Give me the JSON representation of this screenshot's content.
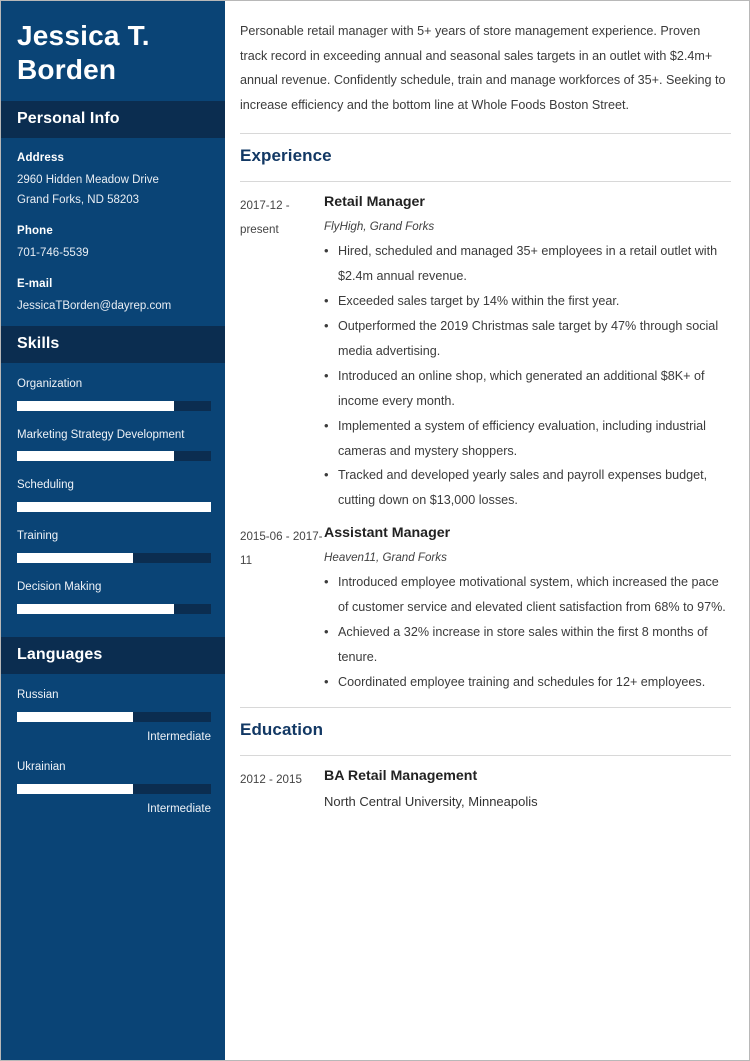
{
  "sidebar": {
    "name_lines": [
      "Jessica T.",
      "Borden"
    ],
    "personal_info": {
      "heading": "Personal Info",
      "groups": [
        {
          "label": "Address",
          "values": [
            "2960 Hidden Meadow Drive",
            "Grand Forks, ND 58203"
          ]
        },
        {
          "label": "Phone",
          "values": [
            "701-746-5539"
          ]
        },
        {
          "label": "E-mail",
          "values": [
            "JessicaTBorden@dayrep.com"
          ]
        }
      ]
    },
    "skills": {
      "heading": "Skills",
      "items": [
        {
          "label": "Organization",
          "level": 81
        },
        {
          "label": "Marketing Strategy Development",
          "level": 81
        },
        {
          "label": "Scheduling",
          "level": 100
        },
        {
          "label": "Training",
          "level": 60
        },
        {
          "label": "Decision Making",
          "level": 81
        }
      ]
    },
    "languages": {
      "heading": "Languages",
      "items": [
        {
          "label": "Russian",
          "level": 60,
          "level_label": "Intermediate"
        },
        {
          "label": "Ukrainian",
          "level": 60,
          "level_label": "Intermediate"
        }
      ]
    }
  },
  "main": {
    "summary": "Personable retail manager with 5+ years of store management experience. Proven track record in exceeding annual and seasonal sales targets in an outlet with $2.4m+ annual revenue. Confidently schedule, train and manage workforces of 35+. Seeking to increase efficiency and the bottom line at Whole Foods Boston Street.",
    "experience": {
      "heading": "Experience",
      "entries": [
        {
          "dates": "2017-12 - present",
          "title": "Retail Manager",
          "subtitle": "FlyHigh, Grand Forks",
          "bullets": [
            "Hired, scheduled and managed 35+ employees in a retail outlet with $2.4m annual revenue.",
            "Exceeded sales target by 14% within the first year.",
            "Outperformed the 2019 Christmas sale target by 47% through social media advertising.",
            "Introduced an online shop, which generated an additional $8K+ of income every month.",
            "Implemented a system of efficiency evaluation, including industrial cameras and mystery shoppers.",
            "Tracked and developed yearly sales and payroll expenses budget, cutting down on $13,000 losses."
          ]
        },
        {
          "dates": "2015-06 - 2017-11",
          "title": "Assistant Manager",
          "subtitle": "Heaven11, Grand Forks",
          "bullets": [
            "Introduced employee motivational system, which increased the pace of customer service and elevated client satisfaction from 68% to 97%.",
            "Achieved a 32% increase in store sales within the first 8 months of tenure.",
            "Coordinated employee training and schedules for 12+ employees."
          ]
        }
      ]
    },
    "education": {
      "heading": "Education",
      "entries": [
        {
          "dates": "2012 - 2015",
          "title": "BA Retail Management",
          "school": "North Central University, Minneapolis"
        }
      ]
    }
  }
}
